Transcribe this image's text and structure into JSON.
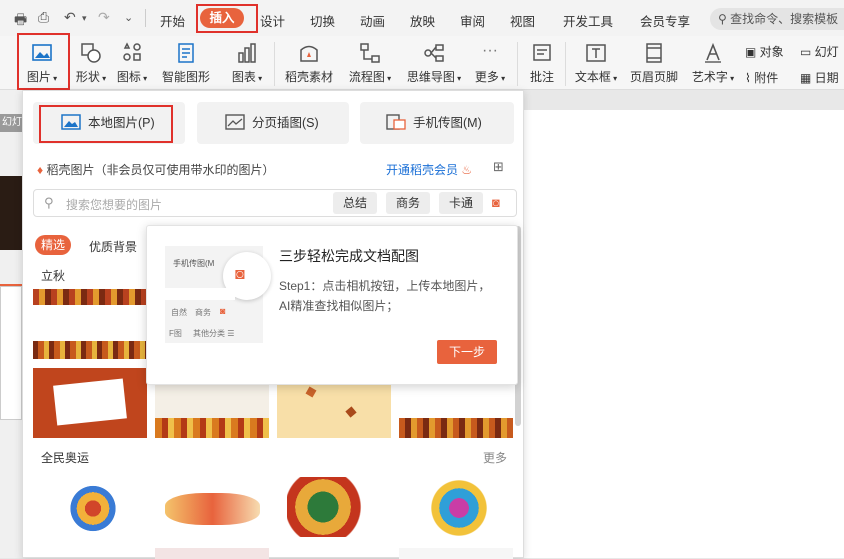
{
  "menubar": {
    "tabs": [
      "开始",
      "插入",
      "设计",
      "切换",
      "动画",
      "放映",
      "审阅",
      "视图",
      "开发工具",
      "会员专享"
    ],
    "active_tab": "插入",
    "search_placeholder": "查找命令、搜索模板"
  },
  "ribbon": {
    "items": [
      {
        "label": "图片"
      },
      {
        "label": "形状"
      },
      {
        "label": "图标"
      },
      {
        "label": "智能图形"
      },
      {
        "label": "图表"
      },
      {
        "label": "稻壳素材"
      },
      {
        "label": "流程图"
      },
      {
        "label": "思维导图"
      },
      {
        "label": "更多"
      },
      {
        "label": "批注"
      },
      {
        "label": "文本框"
      },
      {
        "label": "页眉页脚"
      },
      {
        "label": "艺术字"
      }
    ],
    "small": [
      "对象",
      "幻灯",
      "附件",
      "日期"
    ]
  },
  "left_strip": {
    "label": "幻灯"
  },
  "panel": {
    "source_buttons": [
      "本地图片(P)",
      "分页插图(S)",
      "手机传图(M)"
    ],
    "info": "稻壳图片（非会员仅可使用带水印的图片）",
    "vip_link": "开通稻壳会员",
    "search": {
      "placeholder": "搜索您想要的图片",
      "tags": [
        "总结",
        "商务",
        "卡通"
      ]
    },
    "filters": {
      "active": "精选",
      "other": "优质背景"
    },
    "sections": [
      {
        "title": "立秋",
        "more": ""
      },
      {
        "title": "全民奥运",
        "more": "更多"
      }
    ]
  },
  "popup": {
    "title": "三步轻松完成文档配图",
    "desc_line1": "Step1：点击相机按钮，上传本地图片，",
    "desc_line2": "AI精准查找相似图片；",
    "next_button": "下一步",
    "mini": {
      "header": "手机传图(M",
      "tag1": "自然",
      "tag2": "商务",
      "foot1": "F图",
      "foot2": "其他分类 ☰"
    }
  },
  "colors": {
    "accent": "#e8633d",
    "link": "#1a6fd6",
    "highlight": "#e0312b"
  }
}
